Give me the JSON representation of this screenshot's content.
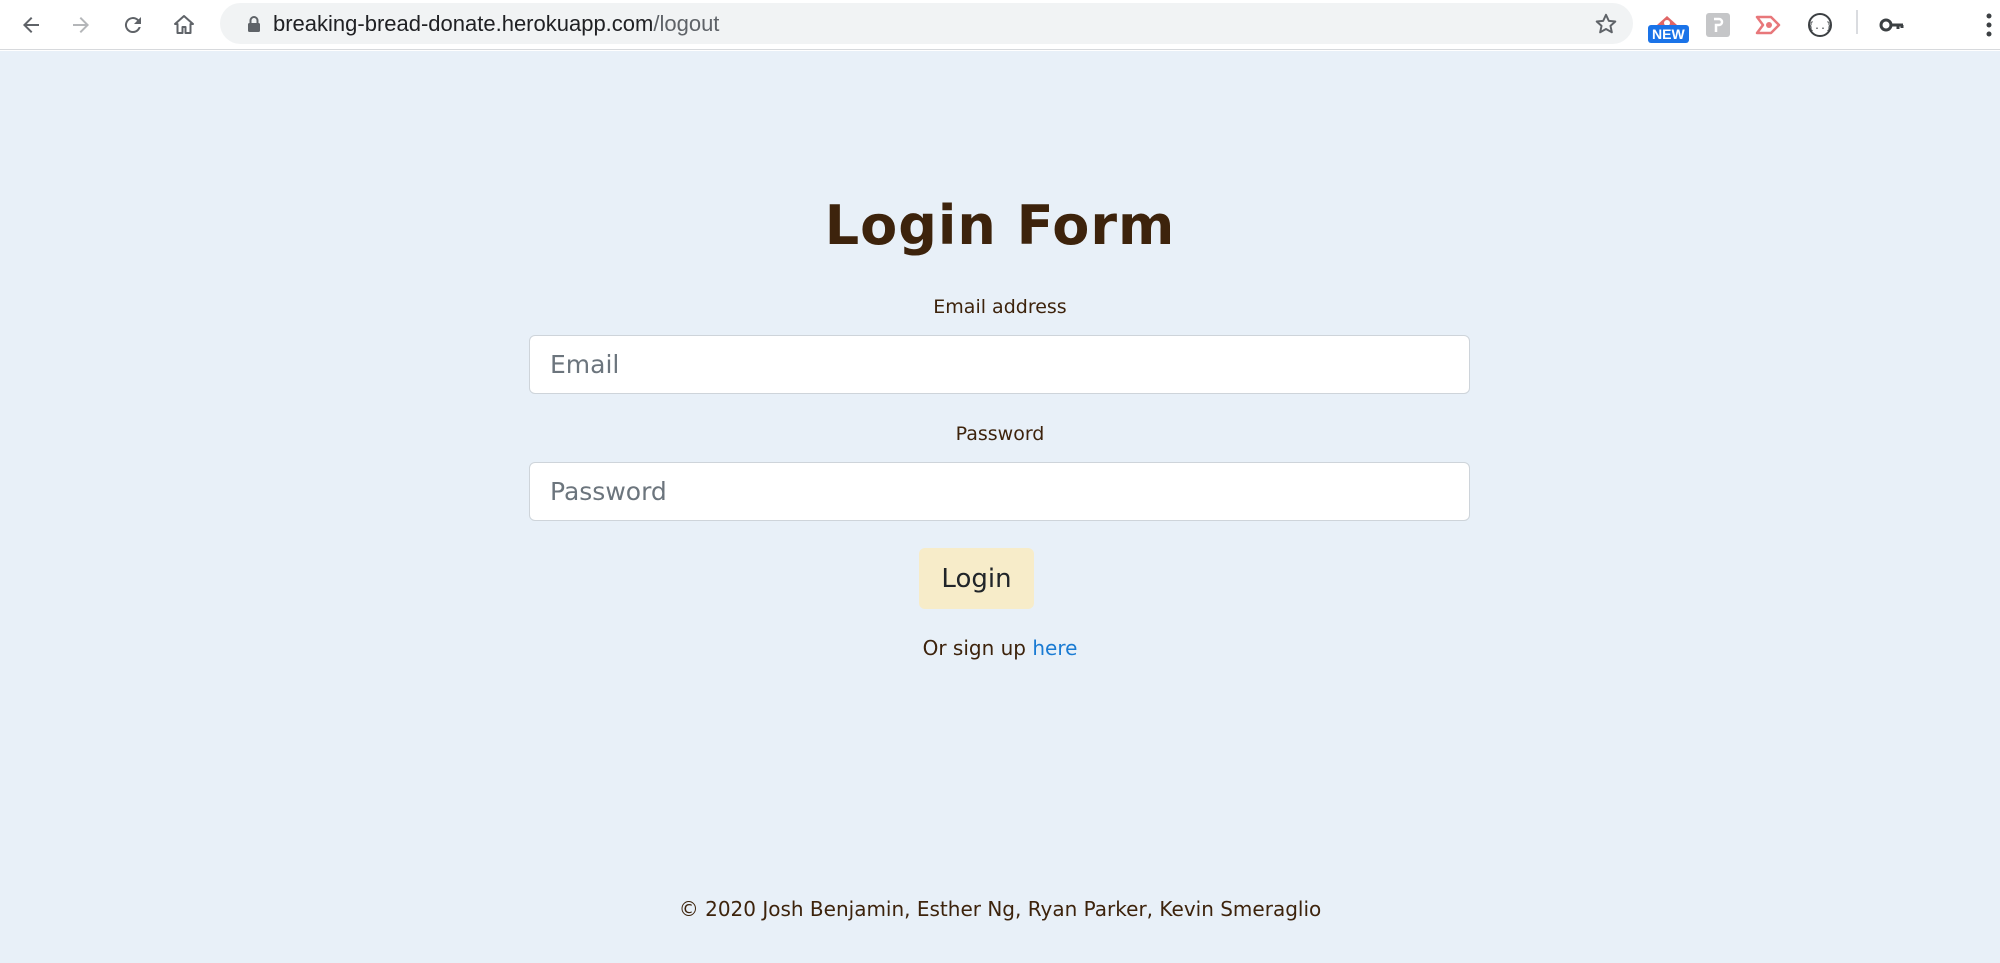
{
  "browser": {
    "url_host": "breaking-bread-donate.herokuapp.com",
    "url_path": "/logout",
    "nav_icons": [
      "back-arrow-icon",
      "forward-arrow-icon",
      "reload-icon",
      "home-icon"
    ],
    "extension_badge": "NEW",
    "extensions": [
      "new-badge-extension-icon",
      "extension-puzzle-icon",
      "extension-play-icon",
      "extension-braces-icon",
      "key-icon",
      "kebab-menu-icon"
    ]
  },
  "form": {
    "title": "Login Form",
    "email_label": "Email address",
    "email_placeholder": "Email",
    "password_label": "Password",
    "password_placeholder": "Password",
    "login_button": "Login",
    "signup_prefix": "Or sign up",
    "signup_link": "here"
  },
  "footer": {
    "text": "© 2020 Josh Benjamin, Esther Ng, Ryan Parker, Kevin Smeraglio"
  },
  "colors": {
    "page_background": "#e8f0f8",
    "text_brown": "#3d230c",
    "button_background": "#f7ecc9",
    "link_blue": "#1a7bd3"
  }
}
